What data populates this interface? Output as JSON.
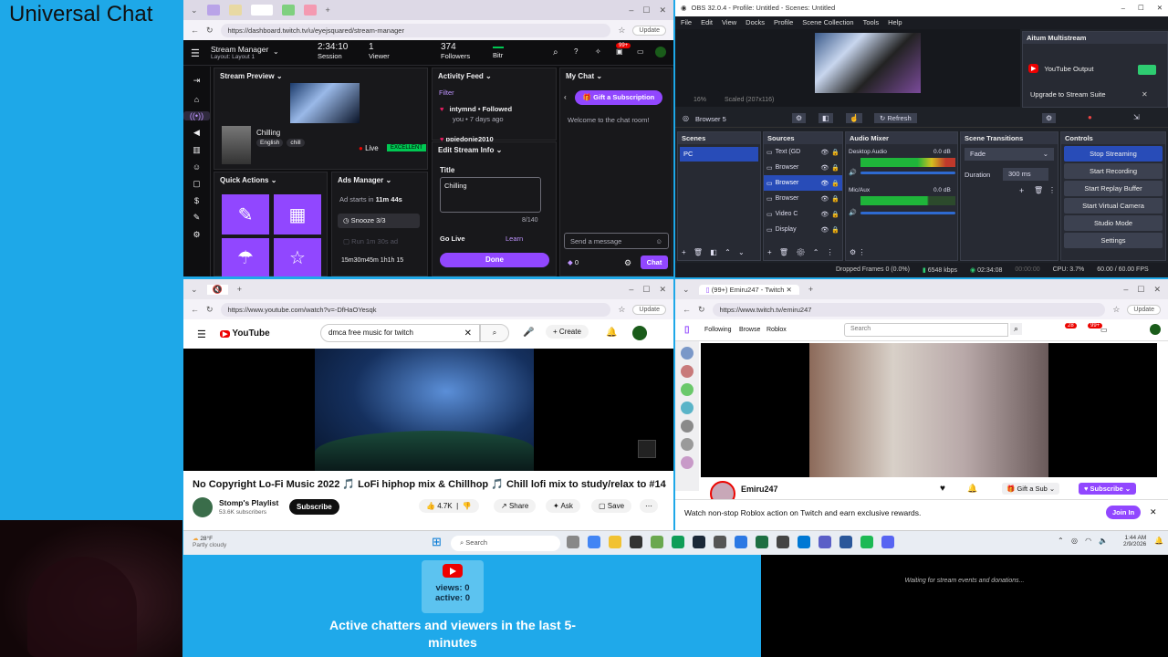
{
  "overlay": {
    "title": "Universal Chat",
    "views": "views: 0",
    "active": "active: 0",
    "chatters_text": "Active chatters and viewers in the last 5-minutes",
    "waiting": "Waiting for stream events and donations..."
  },
  "twitch_dash": {
    "url": "https://dashboard.twitch.tv/u/eyejsquared/stream-manager",
    "title": "Stream Manager",
    "layout": "Layout: Layout 1",
    "session_time": "2:34:10",
    "session_label": "Session",
    "viewers": "1",
    "viewers_label": "Viewer",
    "followers": "374",
    "followers_label": "Followers",
    "bitrate_label": "Bitr",
    "badge": "99+",
    "preview_header": "Stream Preview",
    "stream_title": "Chilling",
    "lang_tag": "English",
    "tag": "chill",
    "live": "Live",
    "quality": "EXCELLENT",
    "quick_actions": "Quick Actions",
    "ads_manager": "Ads Manager",
    "ad_starts": "Ad starts in",
    "ad_time": "11m 44s",
    "snooze": "Snooze 3/3",
    "run_ad": "Run 1m 30s ad",
    "ad_footer": "15m30m45m 1h1h 15",
    "activity_header": "Activity Feed",
    "filter": "Filter",
    "activity_user": "intymnd",
    "activity_action": "• Followed",
    "activity_sub": "you • 7 days ago",
    "activity_user2": "ppiedonie2010",
    "edit_header": "Edit Stream Info",
    "title_label": "Title",
    "title_value": "Chilling",
    "title_count": "8/140",
    "go_live": "Go Live",
    "learn": "Learn",
    "done": "Done",
    "chat_header": "My Chat",
    "gift_sub": "Gift a Subscription",
    "welcome": "Welcome to the chat room!",
    "send_placeholder": "Send a message",
    "points": "0",
    "chat_btn": "Chat",
    "update": "Update"
  },
  "obs": {
    "title": "OBS 32.0.4 - Profile: Untitled - Scenes: Untitled",
    "menu": [
      "File",
      "Edit",
      "View",
      "Docks",
      "Profile",
      "Scene Collection",
      "Tools",
      "Help"
    ],
    "multistream": "Aitum Multistream",
    "yt_output": "YouTube Output",
    "upgrade": "Upgrade to Stream Suite",
    "scaled": "Scaled (207x116)",
    "zoom": "16%",
    "source_name": "Browser 5",
    "refresh": "Refresh",
    "scenes_hd": "Scenes",
    "scene": "PC",
    "sources_hd": "Sources",
    "sources": [
      "Text (GD",
      "Browser",
      "Browser",
      "Browser",
      "Video C",
      "Display"
    ],
    "mixer_hd": "Audio Mixer",
    "desktop_audio": "Desktop Audio",
    "mic_aux": "Mic/Aux",
    "db1": "0.0 dB",
    "db2": "0.0 dB",
    "transitions_hd": "Scene Transitions",
    "fade": "Fade",
    "duration_label": "Duration",
    "duration": "300 ms",
    "controls_hd": "Controls",
    "controls": [
      "Stop Streaming",
      "Start Recording",
      "Start Replay Buffer",
      "Start Virtual Camera",
      "Studio Mode",
      "Settings"
    ],
    "status": {
      "dropped": "Dropped Frames 0 (0.0%)",
      "kbps": "6548 kbps",
      "time": "02:34:08",
      "rec": "00:00:00",
      "cpu": "CPU: 3.7%",
      "fps": "60.00 / 60.00 FPS"
    }
  },
  "youtube": {
    "url": "https://www.youtube.com/watch?v=-DfHaOYesqk",
    "logo": "YouTube",
    "search": "dmca free music for twitch",
    "create": "Create",
    "video_title": "No Copyright Lo-Fi Music 2022 🎵 LoFi hiphop mix & Chillhop 🎵 Chill lofi mix to study/relax to #14",
    "channel": "Stomp's Playlist",
    "subs": "53.6K subscribers",
    "subscribe": "Subscribe",
    "likes": "4.7K",
    "share": "Share",
    "ask": "Ask",
    "save": "Save",
    "update": "Update"
  },
  "twitch_view": {
    "tab": "(99+) Emiru247 - Twitch",
    "url": "https://www.twitch.tv/emiru247",
    "following": "Following",
    "browse": "Browse",
    "roblox": "Roblox",
    "search": "Search",
    "badge1": "28",
    "badge2": "99+",
    "streamer": "Emiru247",
    "gift": "Gift a Sub",
    "subscribe": "Subscribe",
    "promo": "Watch non-stop Roblox action on Twitch and earn exclusive rewards.",
    "join": "Join In",
    "update": "Update"
  },
  "taskbar": {
    "weather_temp": "28°F",
    "weather": "Partly cloudy",
    "search": "Search",
    "time": "1:44 AM",
    "date": "2/9/2026"
  }
}
